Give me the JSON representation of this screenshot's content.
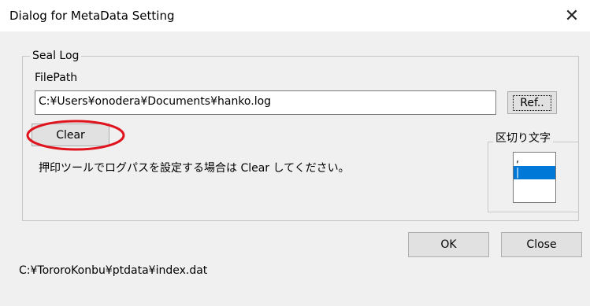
{
  "window": {
    "title": "Dialog for MetaData Setting",
    "close_glyph": "✕"
  },
  "seal_log": {
    "group_label": "Seal Log",
    "filepath_label": "FilePath",
    "filepath_value": "C:¥Users¥onodera¥Documents¥hanko.log",
    "ref_button": "Ref..",
    "clear_button": "Clear",
    "hint": "押印ツールでログパスを設定する場合は Clear してください。"
  },
  "separator": {
    "group_label": "区切り文字",
    "items": [
      ",",
      "|"
    ],
    "selected_index": 1
  },
  "footer": {
    "ok_button": "OK",
    "close_button": "Close",
    "status_path": "C:¥TororoKonbu¥ptdata¥index.dat"
  },
  "colors": {
    "highlight": "#e0141e",
    "selection": "#0078d7",
    "dialog_bg": "#f0f0f0"
  }
}
